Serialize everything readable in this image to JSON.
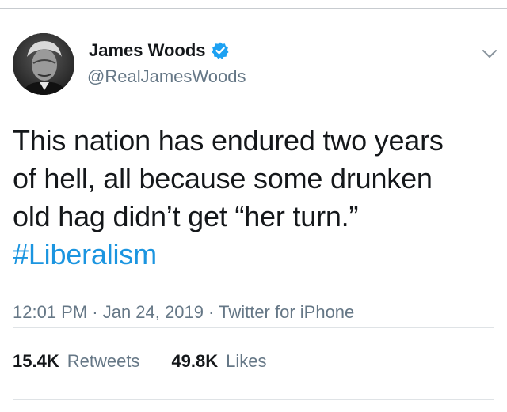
{
  "tweet": {
    "author": {
      "display_name": "James Woods",
      "handle": "@RealJamesWoods",
      "verified": true
    },
    "text_lines": [
      "This nation has endured two years",
      "of hell, all because some drunken",
      "old hag didn’t get “her turn.”"
    ],
    "hashtag": "#Liberalism",
    "meta": "12:01 PM · Jan 24, 2019 · Twitter for iPhone",
    "stats": {
      "retweets_count": "15.4K",
      "retweets_label": "Retweets",
      "likes_count": "49.8K",
      "likes_label": "Likes"
    }
  },
  "colors": {
    "text": "#14171a",
    "secondary": "#657786",
    "link": "#1b95e0",
    "verified": "#1da1f2",
    "divider": "#dfe3e6"
  },
  "icons": {
    "verified": "verified-badge-icon",
    "menu": "chevron-down-icon"
  }
}
